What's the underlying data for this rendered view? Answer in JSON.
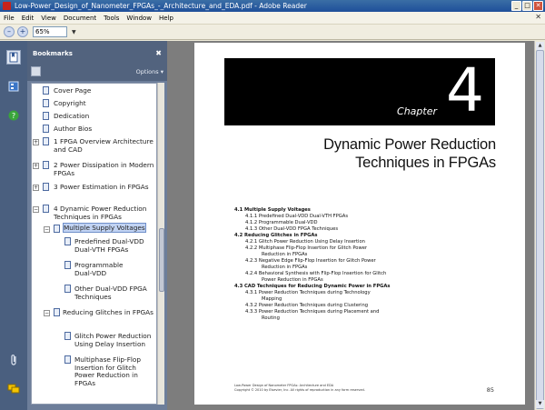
{
  "window": {
    "title": "Low-Power_Design_of_Nanometer_FPGAs_-_Architecture_and_EDA.pdf - Adobe Reader",
    "btn_min": "_",
    "btn_max": "□",
    "btn_close": "✕",
    "doc_close": "✕"
  },
  "menu": [
    "File",
    "Edit",
    "View",
    "Document",
    "Tools",
    "Window",
    "Help"
  ],
  "toolbar": {
    "zoom_value": "65%",
    "zoom_out_glyph": "–",
    "zoom_in_glyph": "+",
    "dropdown_glyph": "▼"
  },
  "bookmarks_panel": {
    "title": "Bookmarks",
    "close_glyph": "✖",
    "options_label": "Options ▾",
    "items": [
      "Cover Page",
      "Copyright",
      "Dedication",
      "Author Bios",
      "1 FPGA Overview Architecture and CAD",
      "2 Power Dissipation in Modern FPGAs",
      "3 Power Estimation in FPGAs",
      "4 Dynamic Power Reduction Techniques in FPGAs",
      "Multiple Supply Voltages",
      "Predefined Dual-VDD Dual-VTH FPGAs",
      "Programmable Dual-VDD",
      "Other Dual-VDD FPGA Techniques",
      "Reducing Glitches in FPGAs",
      "Glitch Power Reduction Using Delay Insertion",
      "Multiphase Flip-Flop Insertion for Glitch Power Reduction in FPGAs"
    ]
  },
  "page": {
    "chapter_word": "Chapter",
    "chapter_number": "4",
    "title_line1": "Dynamic Power Reduction",
    "title_line2": "Techniques in FPGAs",
    "toc": [
      "4.1  Multiple Supply Voltages",
      "4.1.1  Predefined Dual-VDD Dual-VTH FPGAs",
      "4.1.2  Programmable Dual-VDD",
      "4.1.3  Other Dual-VDD FPGA Techniques",
      "4.2  Reducing Glitches in FPGAs",
      "4.2.1  Glitch Power Reduction Using Delay Insertion",
      "4.2.2  Multiphase Flip-Flop Insertion for Glitch Power",
      "Reduction in FPGAs",
      "4.2.3  Negative Edge Flip-Flop Insertion for Glitch Power",
      "Reduction in FPGAs",
      "4.2.4  Behavioral Synthesis with Flip-Flop Insertion for Glitch",
      "Power Reduction in FPGAs",
      "4.3  CAD Techniques for Reducing Dynamic Power in FPGAs",
      "4.3.1  Power Reduction Techniques during Technology",
      "Mapping",
      "4.3.2  Power Reduction Techniques during Clustering",
      "4.3.3  Power Reduction Techniques during Placement and",
      "Routing"
    ],
    "footer_line1": "Low-Power Design of Nanometer FPGAs: Architecture and EDA",
    "footer_line2": "Copyright © 2010 by Elsevier, Inc. All rights of reproduction in any form reserved.",
    "page_number": "85"
  },
  "scroll": {
    "up": "▲",
    "down": "▼"
  },
  "accent_color": "#1f4f9a"
}
